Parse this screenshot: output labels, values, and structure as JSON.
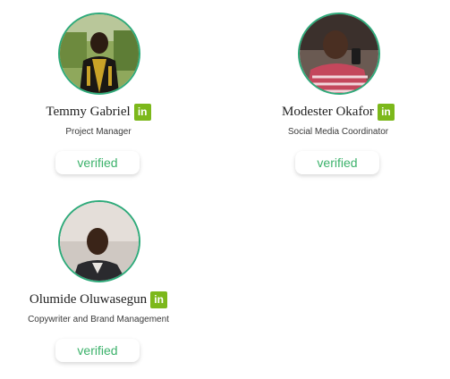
{
  "team": [
    {
      "name": "Temmy Gabriel",
      "role": "Project Manager",
      "status": "verified",
      "social": "in",
      "social_icon": "linkedin-icon"
    },
    {
      "name": "Modester Okafor",
      "role": "Social Media Coordinator",
      "status": "verified",
      "social": "in",
      "social_icon": "linkedin-icon"
    },
    {
      "name": "Olumide Oluwasegun",
      "role": "Copywriter and Brand Management",
      "status": "verified",
      "social": "in",
      "social_icon": "linkedin-icon"
    }
  ],
  "colors": {
    "accent_ring": "#2eaa7a",
    "linkedin_badge": "#7cb81b",
    "verified_text": "#3cb26b"
  }
}
